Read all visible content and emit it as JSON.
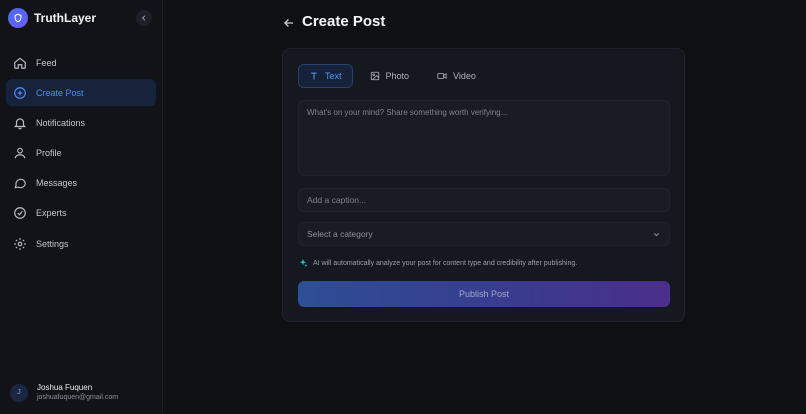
{
  "app": {
    "name": "TruthLayer"
  },
  "sidebar": {
    "items": [
      {
        "label": "Feed",
        "icon": "home-icon",
        "active": false
      },
      {
        "label": "Create Post",
        "icon": "plus-circle-icon",
        "active": true
      },
      {
        "label": "Notifications",
        "icon": "bell-icon",
        "active": false
      },
      {
        "label": "Profile",
        "icon": "user-icon",
        "active": false
      },
      {
        "label": "Messages",
        "icon": "message-icon",
        "active": false
      },
      {
        "label": "Experts",
        "icon": "check-circle-icon",
        "active": false
      },
      {
        "label": "Settings",
        "icon": "gear-icon",
        "active": false
      }
    ]
  },
  "user": {
    "initial": "J",
    "name": "Joshua Fuquen",
    "email": "joshuafuquen@gmail.com"
  },
  "page": {
    "title": "Create Post"
  },
  "composer": {
    "tabs": [
      {
        "label": "Text",
        "icon": "text-icon",
        "active": true
      },
      {
        "label": "Photo",
        "icon": "image-icon",
        "active": false
      },
      {
        "label": "Video",
        "icon": "video-icon",
        "active": false
      }
    ],
    "body_placeholder": "What's on your mind? Share something worth verifying...",
    "caption_placeholder": "Add a caption...",
    "category_placeholder": "Select a category",
    "ai_note": "AI will automatically analyze your post for content type and credibility after publishing.",
    "publish_label": "Publish Post"
  },
  "colors": {
    "accent": "#4f8cf7",
    "background": "#0e1014",
    "card": "#15181e"
  }
}
